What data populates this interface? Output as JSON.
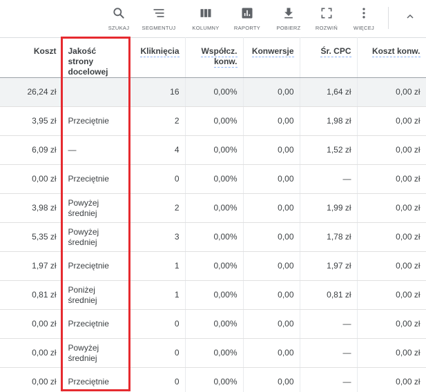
{
  "toolbar": {
    "items": [
      {
        "label": "SZUKAJ",
        "icon": "search-icon"
      },
      {
        "label": "SEGMENTUJ",
        "icon": "segment-icon"
      },
      {
        "label": "KOLUMNY",
        "icon": "columns-icon"
      },
      {
        "label": "RAPORTY",
        "icon": "reports-icon"
      },
      {
        "label": "POBIERZ",
        "icon": "download-icon"
      },
      {
        "label": "ROZWIŃ",
        "icon": "expand-icon"
      },
      {
        "label": "WIĘCEJ",
        "icon": "more-vert-icon"
      }
    ],
    "collapse_icon": "chevron-up-icon"
  },
  "table": {
    "headers": {
      "cost": "Koszt",
      "quality": "Jakość strony docelowej",
      "clicks": "Kliknięcia",
      "conv_rate": "Współcz. konw.",
      "conversions": "Konwersje",
      "avg_cpc": "Śr. CPC",
      "cost_per_conv": "Koszt konw."
    },
    "total": {
      "cost": "26,24 zł",
      "quality": "",
      "clicks": "16",
      "conv_rate": "0,00%",
      "conversions": "0,00",
      "avg_cpc": "1,64 zł",
      "cost_per_conv": "0,00 zł"
    },
    "rows": [
      {
        "cost": "3,95 zł",
        "quality": "Przeciętnie",
        "clicks": "2",
        "conv_rate": "0,00%",
        "conversions": "0,00",
        "avg_cpc": "1,98 zł",
        "cost_per_conv": "0,00 zł"
      },
      {
        "cost": "6,09 zł",
        "quality": "—",
        "clicks": "4",
        "conv_rate": "0,00%",
        "conversions": "0,00",
        "avg_cpc": "1,52 zł",
        "cost_per_conv": "0,00 zł"
      },
      {
        "cost": "0,00 zł",
        "quality": "Przeciętnie",
        "clicks": "0",
        "conv_rate": "0,00%",
        "conversions": "0,00",
        "avg_cpc": "—",
        "cost_per_conv": "0,00 zł"
      },
      {
        "cost": "3,98 zł",
        "quality": "Powyżej średniej",
        "clicks": "2",
        "conv_rate": "0,00%",
        "conversions": "0,00",
        "avg_cpc": "1,99 zł",
        "cost_per_conv": "0,00 zł"
      },
      {
        "cost": "5,35 zł",
        "quality": "Powyżej średniej",
        "clicks": "3",
        "conv_rate": "0,00%",
        "conversions": "0,00",
        "avg_cpc": "1,78 zł",
        "cost_per_conv": "0,00 zł"
      },
      {
        "cost": "1,97 zł",
        "quality": "Przeciętnie",
        "clicks": "1",
        "conv_rate": "0,00%",
        "conversions": "0,00",
        "avg_cpc": "1,97 zł",
        "cost_per_conv": "0,00 zł"
      },
      {
        "cost": "0,81 zł",
        "quality": "Poniżej średniej",
        "clicks": "1",
        "conv_rate": "0,00%",
        "conversions": "0,00",
        "avg_cpc": "0,81 zł",
        "cost_per_conv": "0,00 zł"
      },
      {
        "cost": "0,00 zł",
        "quality": "Przeciętnie",
        "clicks": "0",
        "conv_rate": "0,00%",
        "conversions": "0,00",
        "avg_cpc": "—",
        "cost_per_conv": "0,00 zł"
      },
      {
        "cost": "0,00 zł",
        "quality": "Powyżej średniej",
        "clicks": "0",
        "conv_rate": "0,00%",
        "conversions": "0,00",
        "avg_cpc": "—",
        "cost_per_conv": "0,00 zł"
      },
      {
        "cost": "0,00 zł",
        "quality": "Przeciętnie",
        "clicks": "0",
        "conv_rate": "0,00%",
        "conversions": "0,00",
        "avg_cpc": "—",
        "cost_per_conv": "0,00 zł"
      }
    ]
  },
  "colors": {
    "highlight": "#e62a2f",
    "total_row_bg": "#f1f3f4",
    "icon": "#5f6368",
    "header_underline": "#8ab4f8"
  }
}
